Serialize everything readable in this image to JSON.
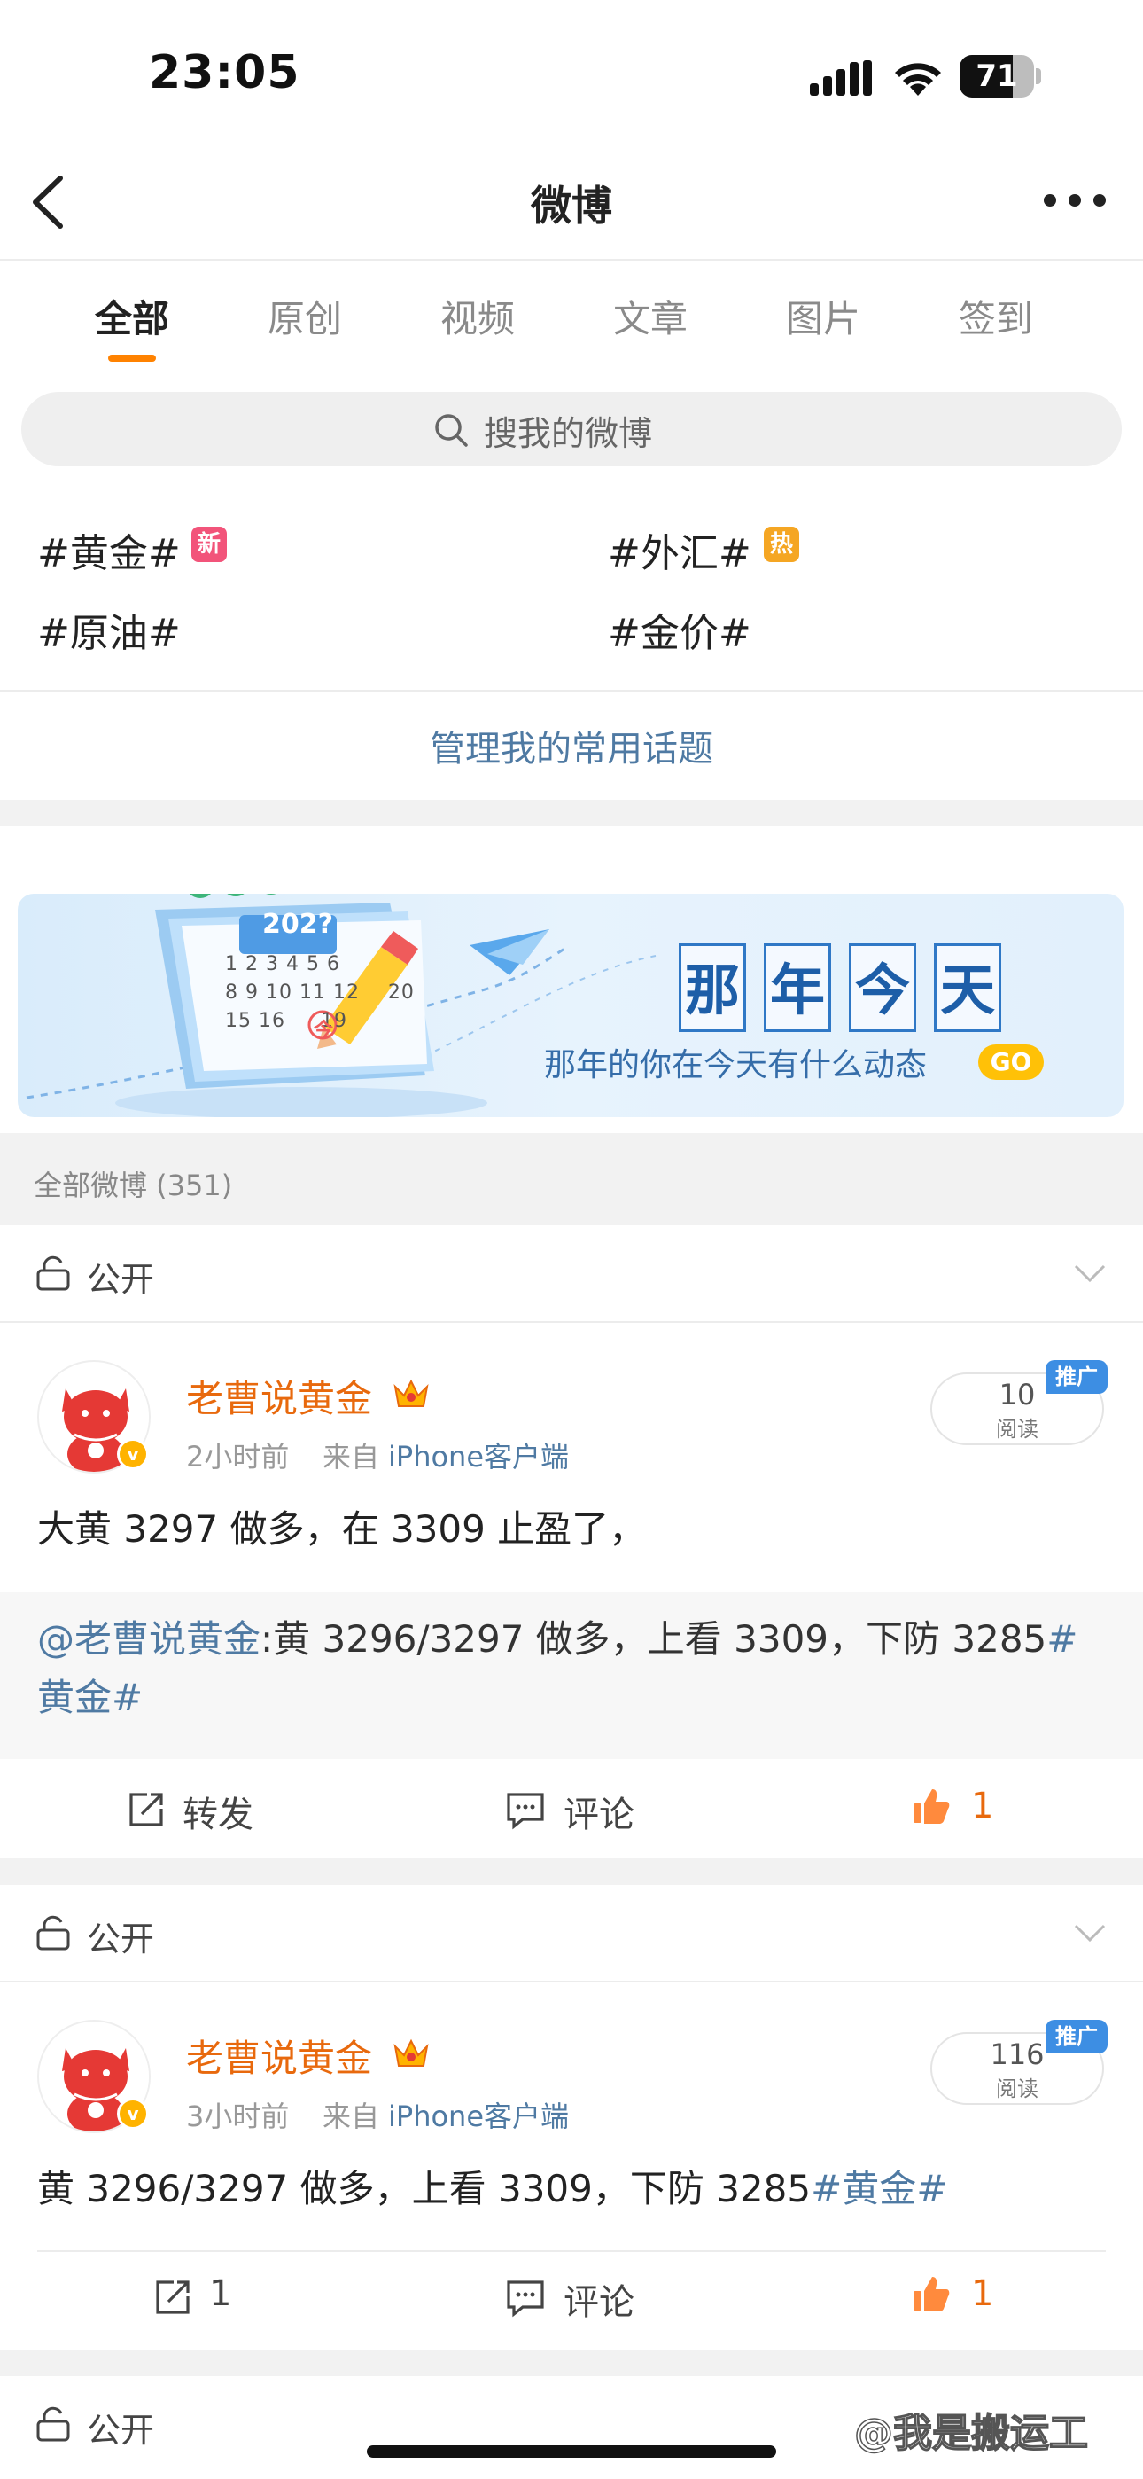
{
  "status_bar": {
    "time": "23:05",
    "battery": "71",
    "battery_level": 0.71
  },
  "nav": {
    "title": "微博"
  },
  "tabs": [
    {
      "label": "全部",
      "active": true
    },
    {
      "label": "原创",
      "active": false
    },
    {
      "label": "视频",
      "active": false
    },
    {
      "label": "文章",
      "active": false
    },
    {
      "label": "图片",
      "active": false
    },
    {
      "label": "签到",
      "active": false
    }
  ],
  "search": {
    "placeholder": "搜我的微博"
  },
  "topics": [
    {
      "label": "#黄金#",
      "badge": "新",
      "badge_color": "#f2547a"
    },
    {
      "label": "#外汇#",
      "badge": "热",
      "badge_color": "#f5a623"
    },
    {
      "label": "#原油#"
    },
    {
      "label": "#金价#"
    }
  ],
  "manage_topics": "管理我的常用话题",
  "banner": {
    "calendar_year": "202?",
    "calendar_today": "今",
    "title_chars": [
      "那",
      "年",
      "今",
      "天"
    ],
    "subtitle": "那年的你在今天有什么动态",
    "go": "GO"
  },
  "all_weibo": "全部微博 (351)",
  "privacy_label": "公开",
  "posts": [
    {
      "author": "老曹说黄金",
      "time": "2小时前",
      "source_prefix": "来自",
      "source": "iPhone客户端",
      "reads": "10",
      "reads_label": "阅读",
      "promo": "推广",
      "text": "大黄 3297 做多，在 3309 止盈了，",
      "repost_author": "@老曹说黄金",
      "repost_text": ":黄 3296/3297 做多，上看 3309，下防 3285",
      "repost_tag": "#黄金#",
      "actions": {
        "repost": "转发",
        "comment": "评论",
        "likes": "1"
      }
    },
    {
      "author": "老曹说黄金",
      "time": "3小时前",
      "source_prefix": "来自",
      "source": "iPhone客户端",
      "reads": "116",
      "reads_label": "阅读",
      "promo": "推广",
      "text": "黄 3296/3297 做多，上看 3309，下防 3285",
      "tag": "#黄金#",
      "actions": {
        "repost": "1",
        "comment": "评论",
        "likes": "1"
      }
    }
  ],
  "watermark": "@我是搬运工"
}
